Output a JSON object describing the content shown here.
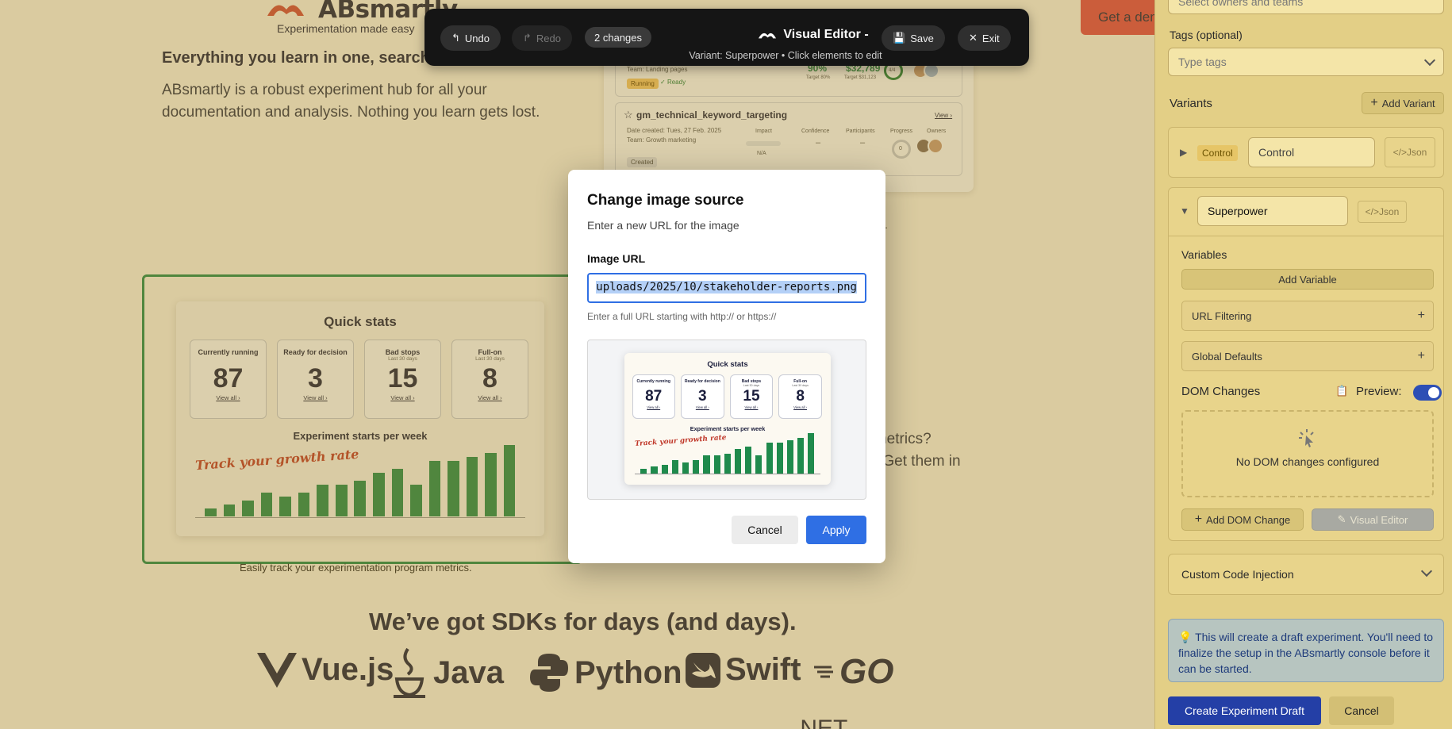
{
  "site": {
    "logo_text": "ABsmartly",
    "tagline": "Experimentation made easy",
    "demo_button": "Get a demo",
    "section_heading": "Everything you learn in one, searchable place.",
    "section_body": "ABsmartly is a robust experiment hub for all your documentation and analysis. Nothing you learn gets lost.",
    "right_caption_fragment": "n.",
    "image_caption": "Easily track your experimentation program metrics.",
    "side_text_line1": "h metrics?",
    "side_text_line2": "rs. Get them in",
    "sdk_heading": "We’ve got SDKs for days (and days).",
    "sdks": [
      "Vue.js",
      "Java",
      "Python",
      "Swift",
      "GO"
    ],
    "sdks_row2": ".NET"
  },
  "experiments_card": {
    "row1": {
      "team": "Team: Landing pages",
      "status": "Running",
      "ready": "Ready",
      "value1": "90%",
      "value2": "$32,789",
      "value1_label": "Target 80%",
      "value2_label": "Target $31,123",
      "progress": "4/4"
    },
    "row2": {
      "name": "gm_technical_keyword_targeting",
      "view": "View ›",
      "date": "Date created: Tues, 27 Feb. 2025",
      "team": "Team: Growth marketing",
      "col_impact": "Impact",
      "col_confidence": "Confidence",
      "col_participants": "Participants",
      "col_progress": "Progress",
      "col_owners": "Owners",
      "impact_value": "N/A",
      "confidence_value": "–",
      "participants_value": "–",
      "progress_value": "0",
      "status": "Created"
    }
  },
  "quick_stats": {
    "title": "Quick stats",
    "boxes": [
      {
        "label": "Currently running",
        "sub": "",
        "value": "87",
        "link": "View all ›"
      },
      {
        "label": "Ready for decision",
        "sub": "",
        "value": "3",
        "link": "View all ›"
      },
      {
        "label": "Bad stops",
        "sub": "Last 30 days",
        "value": "15",
        "link": "View all ›"
      },
      {
        "label": "Full-on",
        "sub": "Last 30 days",
        "value": "8",
        "link": "View all ›"
      }
    ],
    "chart_title": "Experiment starts per week",
    "script_text": "Track your growth rate",
    "bar_values": [
      2,
      3,
      4,
      6,
      5,
      6,
      8,
      8,
      9,
      11,
      12,
      8,
      14,
      14,
      15,
      16,
      18
    ]
  },
  "toolbar": {
    "undo": "Undo",
    "redo": "Redo",
    "changes": "2 changes",
    "title": "Visual Editor -",
    "subtitle": "Variant: Superpower • Click elements to edit",
    "save": "Save",
    "exit": "Exit"
  },
  "modal": {
    "title": "Change image source",
    "subtitle": "Enter a new URL for the image",
    "label": "Image URL",
    "value": "uploads/2025/10/stakeholder-reports.png",
    "help": "Enter a full URL starting with http:// or https://",
    "cancel": "Cancel",
    "apply": "Apply"
  },
  "panel": {
    "owners_placeholder": "Select owners and teams",
    "tags_label": "Tags (optional)",
    "tags_placeholder": "Type tags",
    "variants_label": "Variants",
    "add_variant": "Add Variant",
    "control_badge": "Control",
    "control_name": "Control",
    "json": "</>Json",
    "variant_name": "Superpower",
    "variables_label": "Variables",
    "add_variable": "Add Variable",
    "url_filtering": "URL Filtering",
    "global_defaults": "Global Defaults",
    "dom_changes_label": "DOM Changes",
    "preview_label": "Preview:",
    "preview_on": true,
    "no_dom": "No DOM changes configured",
    "add_dom_change": "Add DOM Change",
    "visual_editor": "Visual Editor",
    "custom_code": "Custom Code Injection",
    "info": "This will create a draft experiment. You'll need to finalize the setup in the ABsmartly console before it can be started.",
    "create_draft": "Create Experiment Draft",
    "cancel": "Cancel"
  },
  "colors": {
    "accent_blue": "#2f6fe4",
    "brand_green": "#1f8a4c",
    "primary_navy": "#243fa6"
  }
}
